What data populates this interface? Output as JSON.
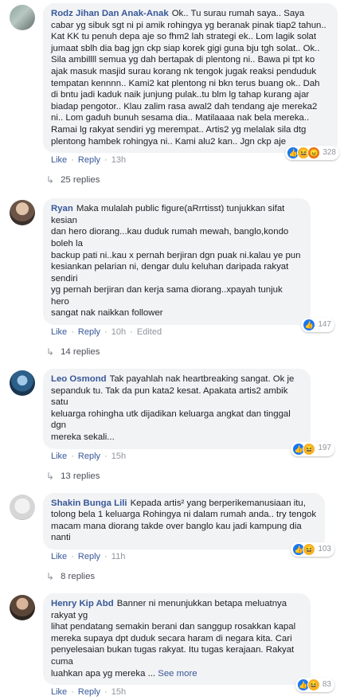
{
  "comments": [
    {
      "author": "Rodz Jihan Dan Anak-Anak",
      "text": "Ok.. Tu surau rumah saya.. Saya\ncabar yg sibuk sgt ni pi amik rohingya yg beranak pinak tiap2 tahun..\nKat KK tu penuh depa aje so fhm2 lah strategi ek.. Lom lagik solat\njumaat sblh dia bag jgn ckp siap korek gigi guna bju tgh solat.. Ok..\nSila ambillll semua yg dah bertapak di plentong ni.. Bawa pi tpt ko\najak masuk masjid surau korang nk tengok jugak reaksi penduduk\ntempatan kennnn.. Kami2 kat plentong ni bkn terus buang ok.. Dah\ndi bntu jadi kaduk naik junjung pulak..tu blm lg tahap kurang ajar\nbiadap pengotor.. Klau zalim rasa awal2 dah tendang aje mereka2\nni.. Lom gaduh bunuh sesama dia.. Matilaaaa nak bela mereka..\nRamai lg rakyat sendiri yg merempat.. Artis2 yg melalak sila dtg\nplentong hambek rohingya ni.. Kami alu2 kan.. Jgn ckp aje",
      "like": "Like",
      "reply": "Reply",
      "time": "13h",
      "edited": "",
      "reaction_count": "328",
      "replies_label": "25 replies"
    },
    {
      "author": "Ryan",
      "text": "Maka mulalah public figure(aRrrtisst) tunjukkan sifat kesian\ndan hero diorang...kau duduk rumah mewah, banglo,kondo boleh la\nbackup pati ni..kau x pernah berjiran dgn puak ni.kalau ye pun\nkesiankan pelarian ni, dengar dulu keluhan daripada rakyat sendiri\nyg pernah berjiran dan kerja sama diorang..xpayah tunjuk hero\nsangat nak naikkan follower",
      "like": "Like",
      "reply": "Reply",
      "time": "10h",
      "edited": "Edited",
      "reaction_count": "147",
      "replies_label": "14 replies"
    },
    {
      "author": "Leo Osmond",
      "text": "Tak payahlah nak heartbreaking sangat. Ok je\nsepanduk tu. Tak da pun kata2 kesat. Apakata artis2 ambik satu\nkeluarga rohingha utk dijadikan keluarga angkat dan tinggal dgn\nmereka sekali...",
      "like": "Like",
      "reply": "Reply",
      "time": "15h",
      "edited": "",
      "reaction_count": "197",
      "replies_label": "13 replies"
    },
    {
      "author": "Shakin Bunga Lili",
      "text": "Kepada artis² yang berperikemanusiaan itu,\ntolong bela 1 keluarga Rohingya ni dalam rumah anda.. try tengok\nmacam mana diorang takde over banglo kau jadi kampung dia nanti",
      "like": "Like",
      "reply": "Reply",
      "time": "11h",
      "edited": "",
      "reaction_count": "103",
      "replies_label": "8 replies"
    },
    {
      "author": "Henry Kip Abd",
      "text": "Banner ni menunjukkan betapa meluatnya rakyat yg\nlihat pendatang semakin berani dan sanggup rosakkan kapal\nmereka supaya dpt duduk secara haram di negara kita. Cari\npenyelesaian bukan tugas rakyat. Itu tugas kerajaan. Rakyat cuma\nluahkan apa yg mereka ...",
      "see_more": "See more",
      "like": "Like",
      "reply": "Reply",
      "time": "15h",
      "edited": "",
      "reaction_count": "83"
    }
  ],
  "colors": {
    "link": "#385898",
    "bubble": "#f2f3f5",
    "like": "#1877f2",
    "haha": "#f7b125",
    "angry": "#e9710f"
  }
}
